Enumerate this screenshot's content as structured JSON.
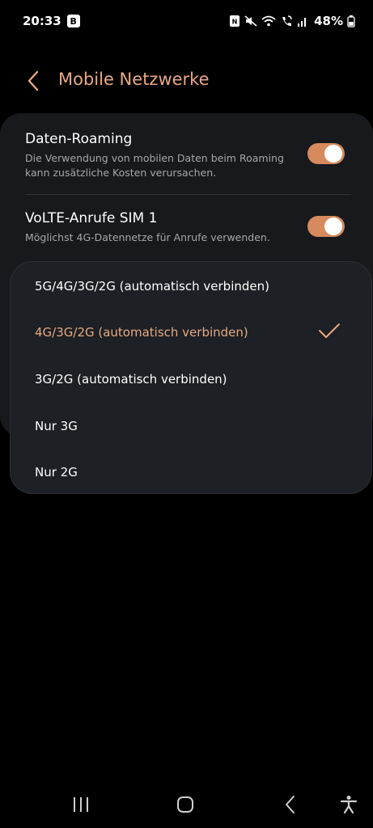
{
  "status_bar": {
    "time": "20:33",
    "badge": "B",
    "battery": "48%",
    "icons": [
      "nfc-icon",
      "mute-icon",
      "wifi-icon",
      "wifi-call-icon",
      "signal-icon",
      "battery-icon"
    ]
  },
  "header": {
    "title": "Mobile Netzwerke",
    "back_icon": "chevron-left-icon"
  },
  "settings": [
    {
      "title": "Daten-Roaming",
      "description": "Die Verwendung von mobilen Daten beim Roaming kann zusätzliche Kosten verursachen.",
      "enabled": true
    },
    {
      "title": "VoLTE-Anrufe SIM 1",
      "description": "Möglichst 4G-Datennetze für Anrufe verwenden.",
      "enabled": true
    }
  ],
  "network_mode_menu": {
    "options": [
      {
        "label": "5G/4G/3G/2G (automatisch verbinden)",
        "selected": false
      },
      {
        "label": "4G/3G/2G (automatisch verbinden)",
        "selected": true
      },
      {
        "label": "3G/2G (automatisch verbinden)",
        "selected": false
      },
      {
        "label": "Nur 3G",
        "selected": false
      },
      {
        "label": "Nur 2G",
        "selected": false
      }
    ]
  },
  "nav_bar": {
    "icons": [
      "recents-icon",
      "home-icon",
      "back-icon",
      "accessibility-icon"
    ]
  },
  "colors": {
    "accent": "#e8a883",
    "toggle": "#d78a5d",
    "card": "#17191c",
    "popup": "#1d2024",
    "background": "#000000"
  }
}
